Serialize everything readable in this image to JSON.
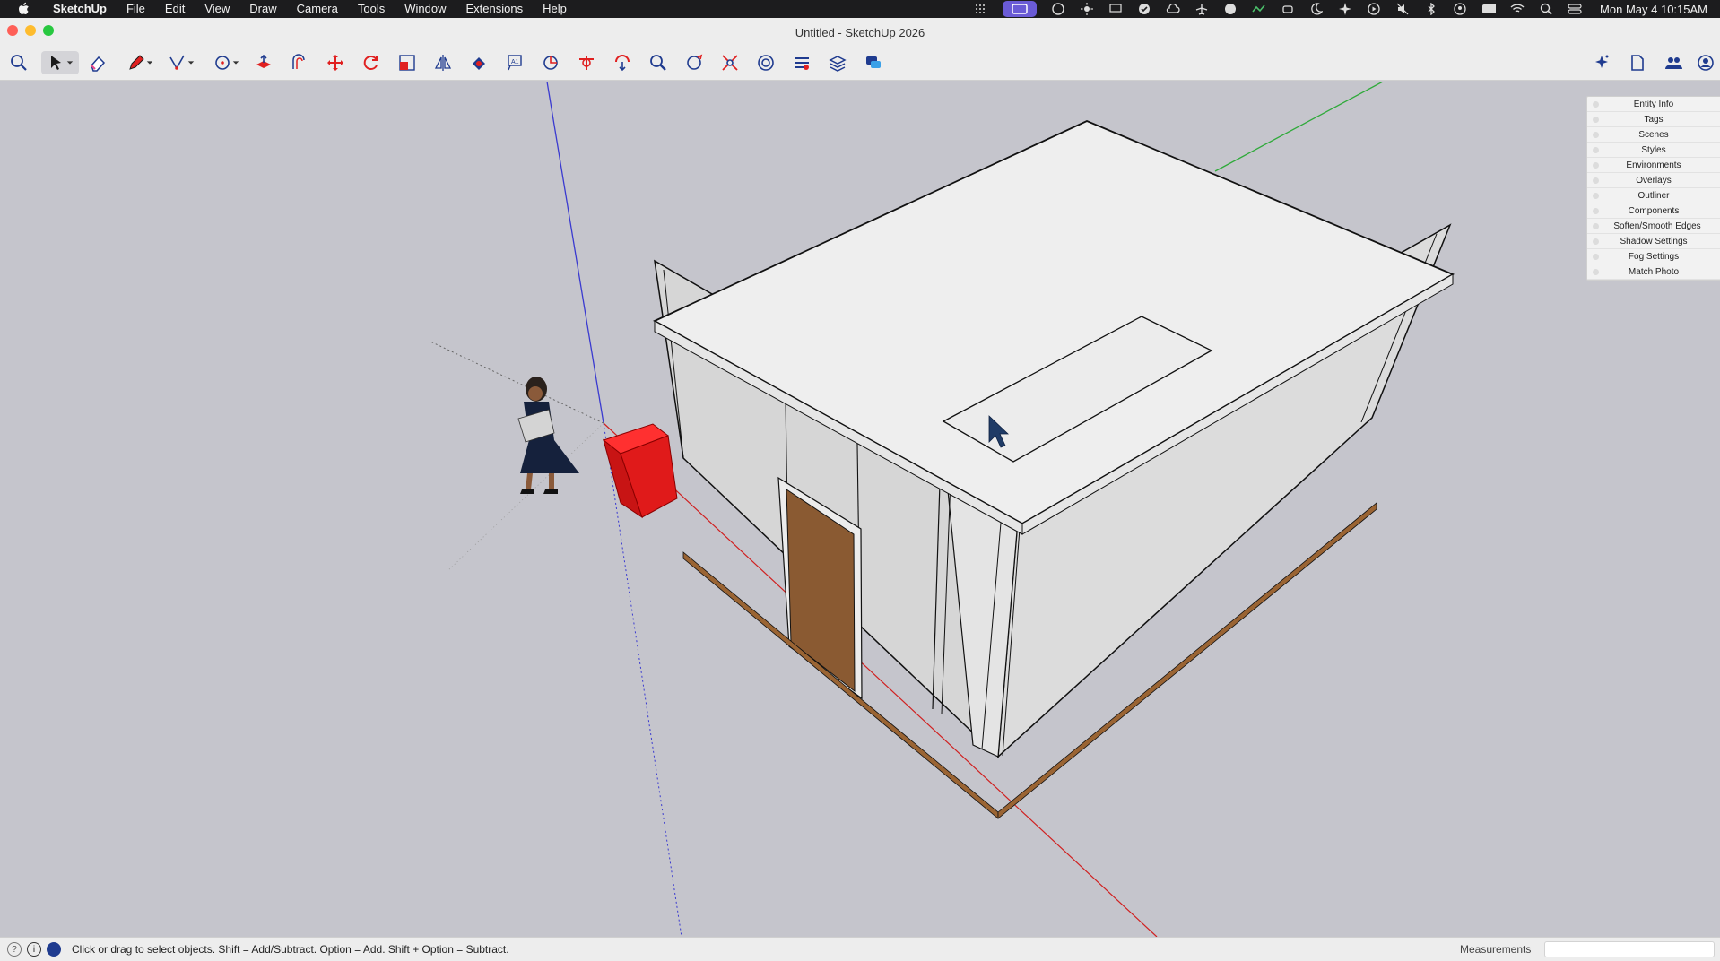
{
  "menubar": {
    "app_name": "SketchUp",
    "items": [
      "File",
      "Edit",
      "View",
      "Draw",
      "Camera",
      "Tools",
      "Window",
      "Extensions",
      "Help"
    ],
    "clock": "Mon May 4  10:15AM"
  },
  "window": {
    "title": "Untitled - SketchUp 2026"
  },
  "toolbar": {
    "tools": [
      "search-icon",
      "select-icon",
      "eraser-icon",
      "pencil-line-icon",
      "freehand-icon",
      "circle-icon",
      "push-pull-icon",
      "offset-icon",
      "move-icon",
      "rotate-icon",
      "scale-icon",
      "flip-icon",
      "paint-icon",
      "text-icon",
      "tape-measure-icon",
      "section-plane-icon",
      "orbit-icon",
      "zoom-icon",
      "walk-icon",
      "zoom-extents-icon",
      "3d-warehouse-icon",
      "extension-warehouse-icon",
      "layout-icon",
      "chat-icon"
    ],
    "right_tools": [
      "ai-assistant-icon",
      "document-icon",
      "users-icon",
      "account-icon"
    ]
  },
  "tray": {
    "items": [
      "Entity Info",
      "Tags",
      "Scenes",
      "Styles",
      "Environments",
      "Overlays",
      "Outliner",
      "Components",
      "Soften/Smooth Edges",
      "Shadow Settings",
      "Fog Settings",
      "Match Photo"
    ]
  },
  "statusbar": {
    "hint": "Click or drag to select objects. Shift = Add/Subtract. Option = Add. Shift + Option = Subtract.",
    "measurements_label": "Measurements",
    "measurements_value": ""
  },
  "colors": {
    "viewport_bg": "#c5c5cc",
    "axis_red": "#d02020",
    "axis_green": "#2faa3a",
    "axis_blue": "#3a3ad0",
    "roof": "#eeeeee",
    "wall": "#dadada",
    "door": "#8a5a32",
    "floor_trim": "#9a6433",
    "cube": "#e01a1a"
  }
}
